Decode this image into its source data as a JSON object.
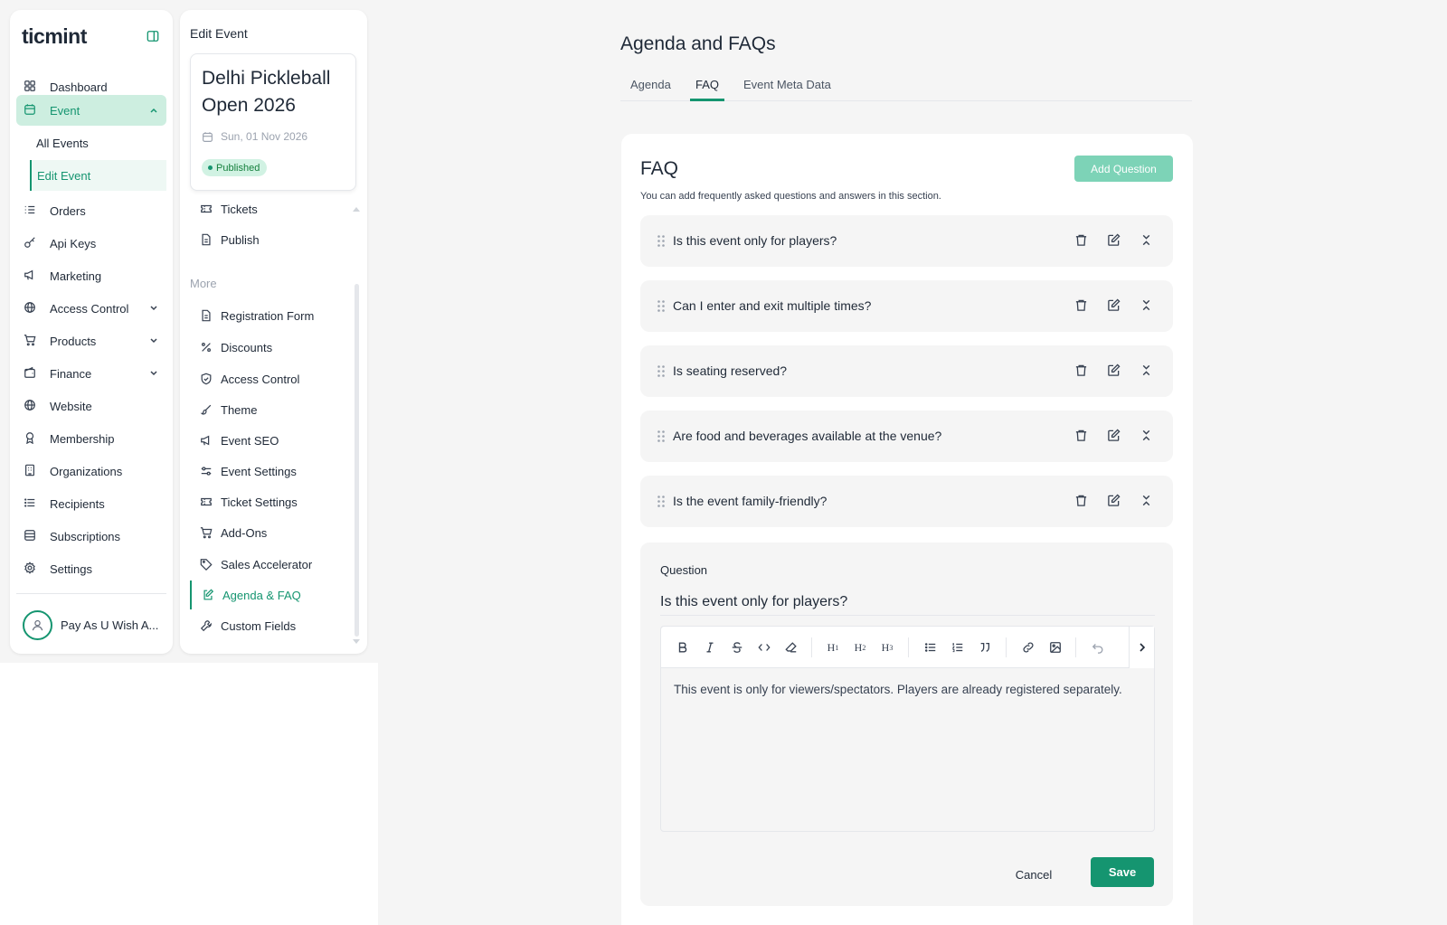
{
  "sidebar": {
    "logo": "ticmint",
    "items": {
      "dashboard": "Dashboard",
      "event": "Event",
      "all_events": "All Events",
      "edit_event": "Edit Event",
      "orders": "Orders",
      "api_keys": "Api Keys",
      "marketing": "Marketing",
      "access_control": "Access Control",
      "products": "Products",
      "finance": "Finance",
      "website": "Website",
      "membership": "Membership",
      "organizations": "Organizations",
      "recipients": "Recipients",
      "subscriptions": "Subscriptions",
      "settings": "Settings"
    },
    "user_name": "Pay As U Wish A..."
  },
  "event_panel": {
    "title": "Edit Event",
    "event_name": "Delhi Pickleball Open 2026",
    "event_date": "Sun, 01 Nov 2026",
    "status": "Published",
    "more_label": "More",
    "items": {
      "tickets": "Tickets",
      "publish": "Publish",
      "registration_form": "Registration Form",
      "discounts": "Discounts",
      "access_control": "Access Control",
      "theme": "Theme",
      "event_seo": "Event SEO",
      "event_settings": "Event Settings",
      "ticket_settings": "Ticket Settings",
      "add_ons": "Add-Ons",
      "sales_accelerator": "Sales Accelerator",
      "agenda_faq": "Agenda & FAQ",
      "custom_fields": "Custom Fields"
    }
  },
  "main": {
    "title": "Agenda and FAQs",
    "tabs": {
      "agenda": "Agenda",
      "faq": "FAQ",
      "meta": "Event Meta Data"
    },
    "faq": {
      "title": "FAQ",
      "description": "You can add frequently asked questions and answers in this section.",
      "add_button": "Add Question",
      "questions": [
        "Is this event only for players?",
        "Can I enter and exit multiple times?",
        "Is seating reserved?",
        "Are food and beverages available at the venue?",
        "Is the event family-friendly?"
      ]
    },
    "editor": {
      "question_label": "Question",
      "question_value": "Is this event only for players?",
      "answer": "This event is only for viewers/spectators. Players are already registered separately.",
      "cancel": "Cancel",
      "save": "Save"
    }
  },
  "colors": {
    "accent": "#159570",
    "accent_light": "#cdeee0",
    "add_button": "#7dd3b7",
    "background": "#f5f5f5"
  }
}
